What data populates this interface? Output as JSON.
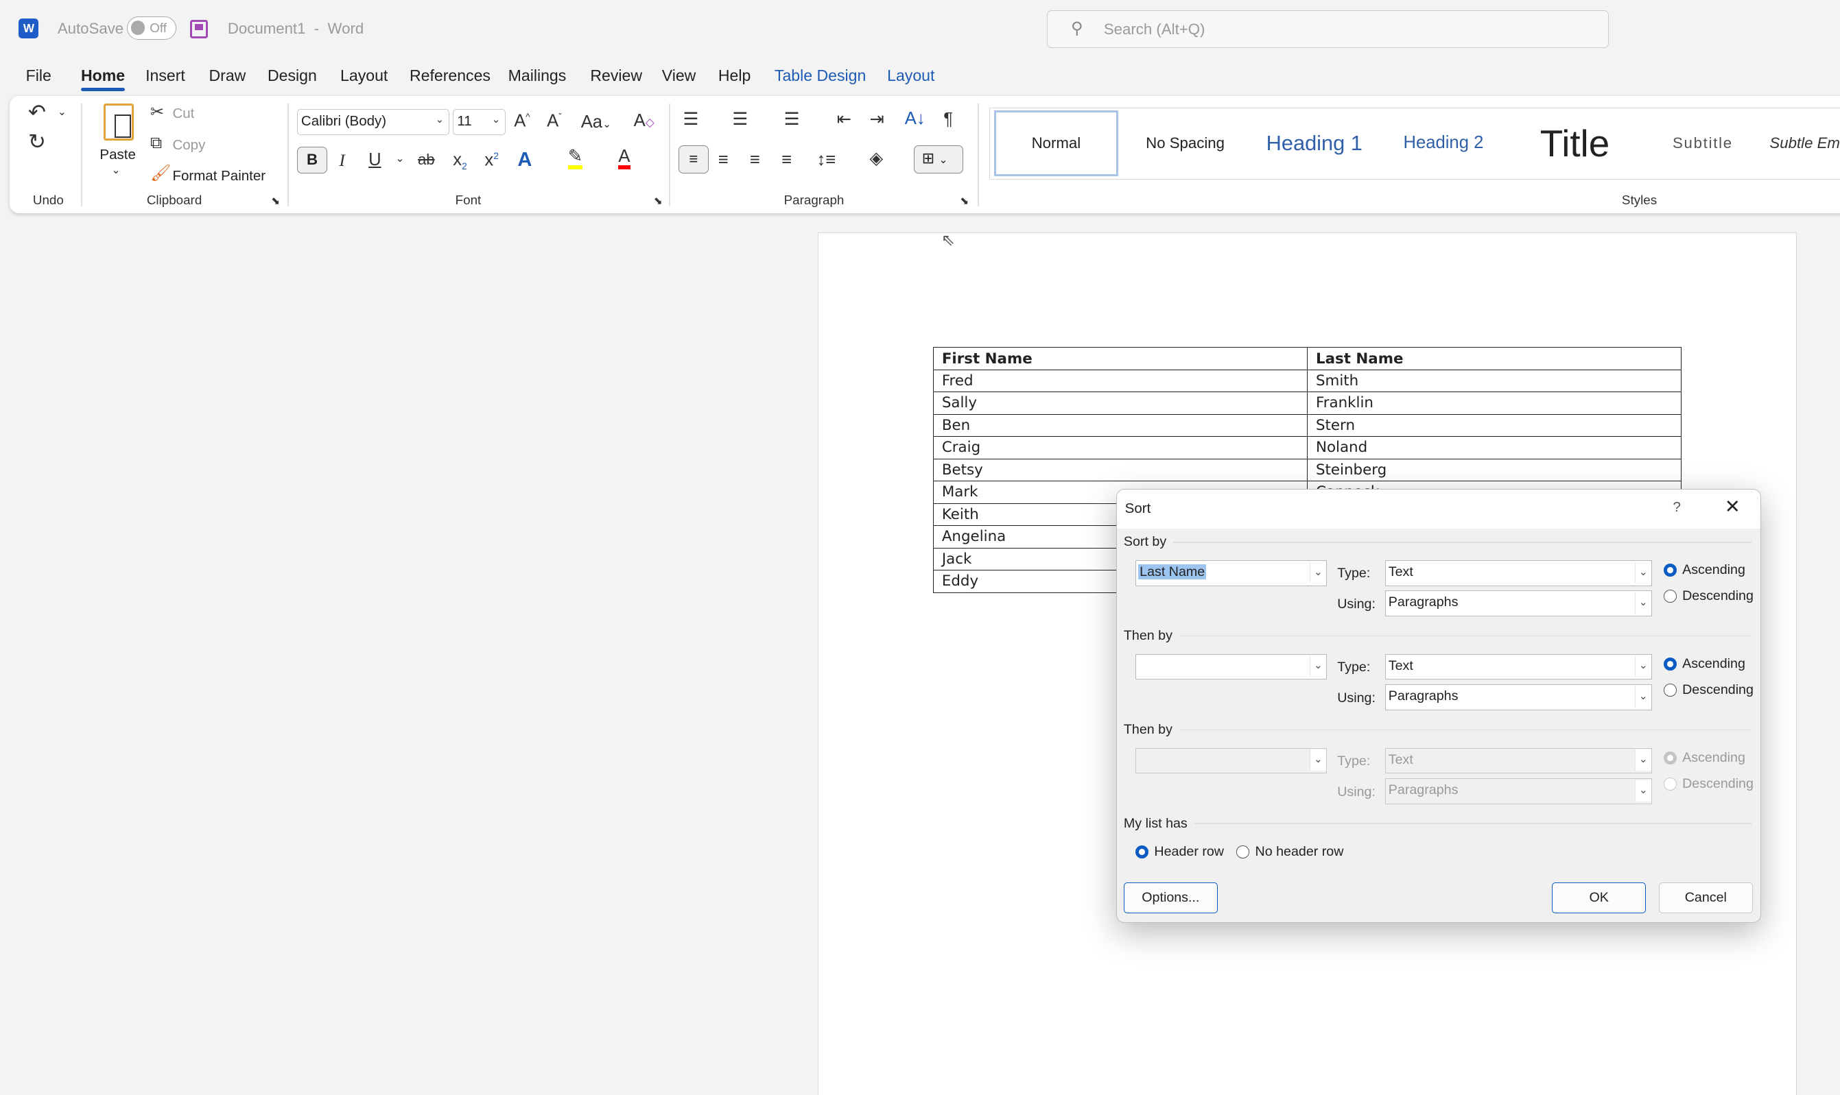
{
  "titlebar": {
    "autosave_label": "AutoSave",
    "autosave_state": "Off",
    "doc_title": "Document1",
    "app_name": "Word",
    "search_placeholder": "Search (Alt+Q)"
  },
  "tabs": [
    {
      "label": "File"
    },
    {
      "label": "Home",
      "active": true
    },
    {
      "label": "Insert"
    },
    {
      "label": "Draw"
    },
    {
      "label": "Design"
    },
    {
      "label": "Layout"
    },
    {
      "label": "References"
    },
    {
      "label": "Mailings"
    },
    {
      "label": "Review"
    },
    {
      "label": "View"
    },
    {
      "label": "Help"
    },
    {
      "label": "Table Design",
      "contextual": true
    },
    {
      "label": "Layout",
      "contextual": true
    }
  ],
  "ribbon": {
    "groups": {
      "undo": "Undo",
      "clipboard": "Clipboard",
      "font": "Font",
      "paragraph": "Paragraph",
      "styles": "Styles"
    },
    "clipboard": {
      "paste": "Paste",
      "cut": "Cut",
      "copy": "Copy",
      "format_painter": "Format Painter"
    },
    "font": {
      "name": "Calibri (Body)",
      "size": "11",
      "bold": "B",
      "italic": "I",
      "underline": "U"
    },
    "styles": [
      "Normal",
      "No Spacing",
      "Heading 1",
      "Heading 2",
      "Title",
      "Subtitle",
      "Subtle Em"
    ],
    "colors": {
      "highlight": "#ffff00",
      "font_color": "#ff0000",
      "accent": "#1d5bb5"
    }
  },
  "document": {
    "table": {
      "headers": [
        "First Name",
        "Last Name"
      ],
      "rows": [
        [
          "Fred",
          "Smith"
        ],
        [
          "Sally",
          "Franklin"
        ],
        [
          "Ben",
          "Stern"
        ],
        [
          "Craig",
          "Noland"
        ],
        [
          "Betsy",
          "Steinberg"
        ],
        [
          "Mark",
          "Cannock"
        ],
        [
          "Keith",
          ""
        ],
        [
          "Angelina",
          ""
        ],
        [
          "Jack",
          ""
        ],
        [
          "Eddy",
          ""
        ]
      ]
    }
  },
  "dialog": {
    "title": "Sort",
    "help": "?",
    "sort_by": {
      "label": "Sort by",
      "column": "Last Name",
      "type": "Text",
      "using": "Paragraphs",
      "order": "Ascending"
    },
    "then_by_1": {
      "label": "Then by",
      "column": "",
      "type": "Text",
      "using": "Paragraphs",
      "order": "Ascending"
    },
    "then_by_2": {
      "label": "Then by",
      "column": "",
      "type": "Text",
      "using": "Paragraphs",
      "order": "Ascending",
      "disabled": true
    },
    "type_label": "Type:",
    "using_label": "Using:",
    "ascending": "Ascending",
    "descending": "Descending",
    "my_list_has": "My list has",
    "header_row": "Header row",
    "no_header_row": "No header row",
    "selected_header": "Header row",
    "options": "Options...",
    "ok": "OK",
    "cancel": "Cancel"
  }
}
